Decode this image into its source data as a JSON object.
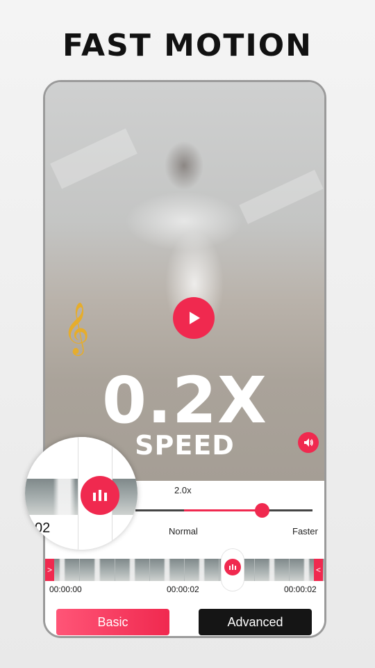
{
  "headline": "FAST MOTION",
  "video": {
    "speed_value": "0.2X",
    "speed_label": "SPEED",
    "play_icon": "play-icon",
    "music_icon": "treble-clef-icon",
    "volume_icon": "speaker-icon"
  },
  "speed_control": {
    "current": "2.0x",
    "label_mid": "Normal",
    "label_end": "Faster",
    "level": 0.72
  },
  "timeline": {
    "start": "00:00:00",
    "mid": "00:00:02",
    "end": "00:00:02",
    "left_handle": ">",
    "right_handle": "<"
  },
  "magnifier": {
    "time_fragment": "02"
  },
  "buttons": {
    "basic": "Basic",
    "advanced": "Advanced"
  },
  "colors": {
    "accent": "#f0294f",
    "dark_button": "#151515",
    "music_icon": "#e6ad2c"
  }
}
